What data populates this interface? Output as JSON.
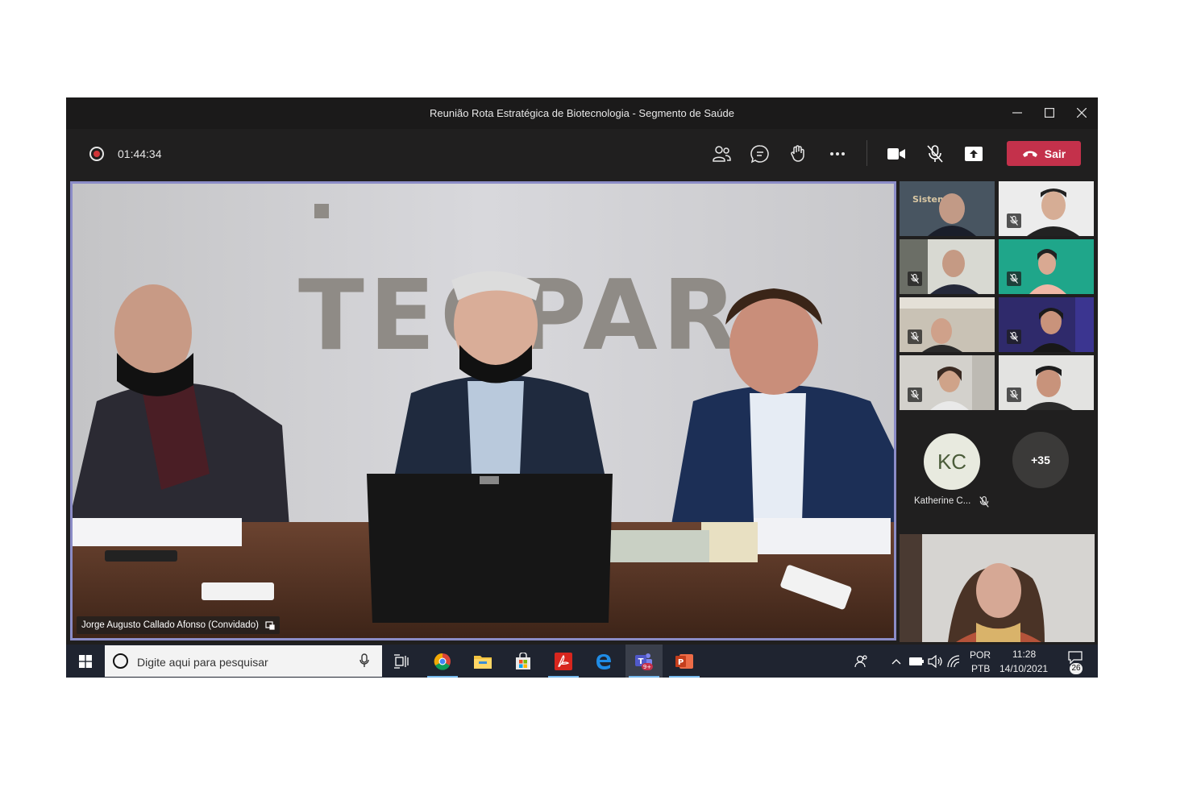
{
  "window": {
    "title": "Reunião Rota Estratégica de Biotecnologia - Segmento de Saúde",
    "minimize_icon": "minimize-icon",
    "maximize_icon": "maximize-icon",
    "close_icon": "close-icon"
  },
  "controls": {
    "recording_time": "01:44:34",
    "leave_label": "Sair",
    "icons": [
      "people-icon",
      "chat-icon",
      "raise-hand-icon",
      "more-icon",
      "camera-icon",
      "mic-off-icon",
      "share-icon",
      "hangup-icon"
    ]
  },
  "main_video": {
    "participant_name": "Jorge Augusto Callado Afonso (Convidado)",
    "wall_logo_text": "TECPAR"
  },
  "participants": {
    "avatar_initials": "KC",
    "avatar_name": "Katherine C...",
    "more_count": "+35",
    "tile_overlay_text": "Sistem Fi"
  },
  "taskbar": {
    "search_placeholder": "Digite aqui para pesquisar",
    "language_top": "POR",
    "language_bottom": "PTB",
    "time": "11:28",
    "date": "14/10/2021",
    "notifications": "26",
    "teams_badge": "9+",
    "colors": {
      "accent": "#76b9ed",
      "leave": "#c4314b",
      "border": "#8b8cc7"
    }
  }
}
